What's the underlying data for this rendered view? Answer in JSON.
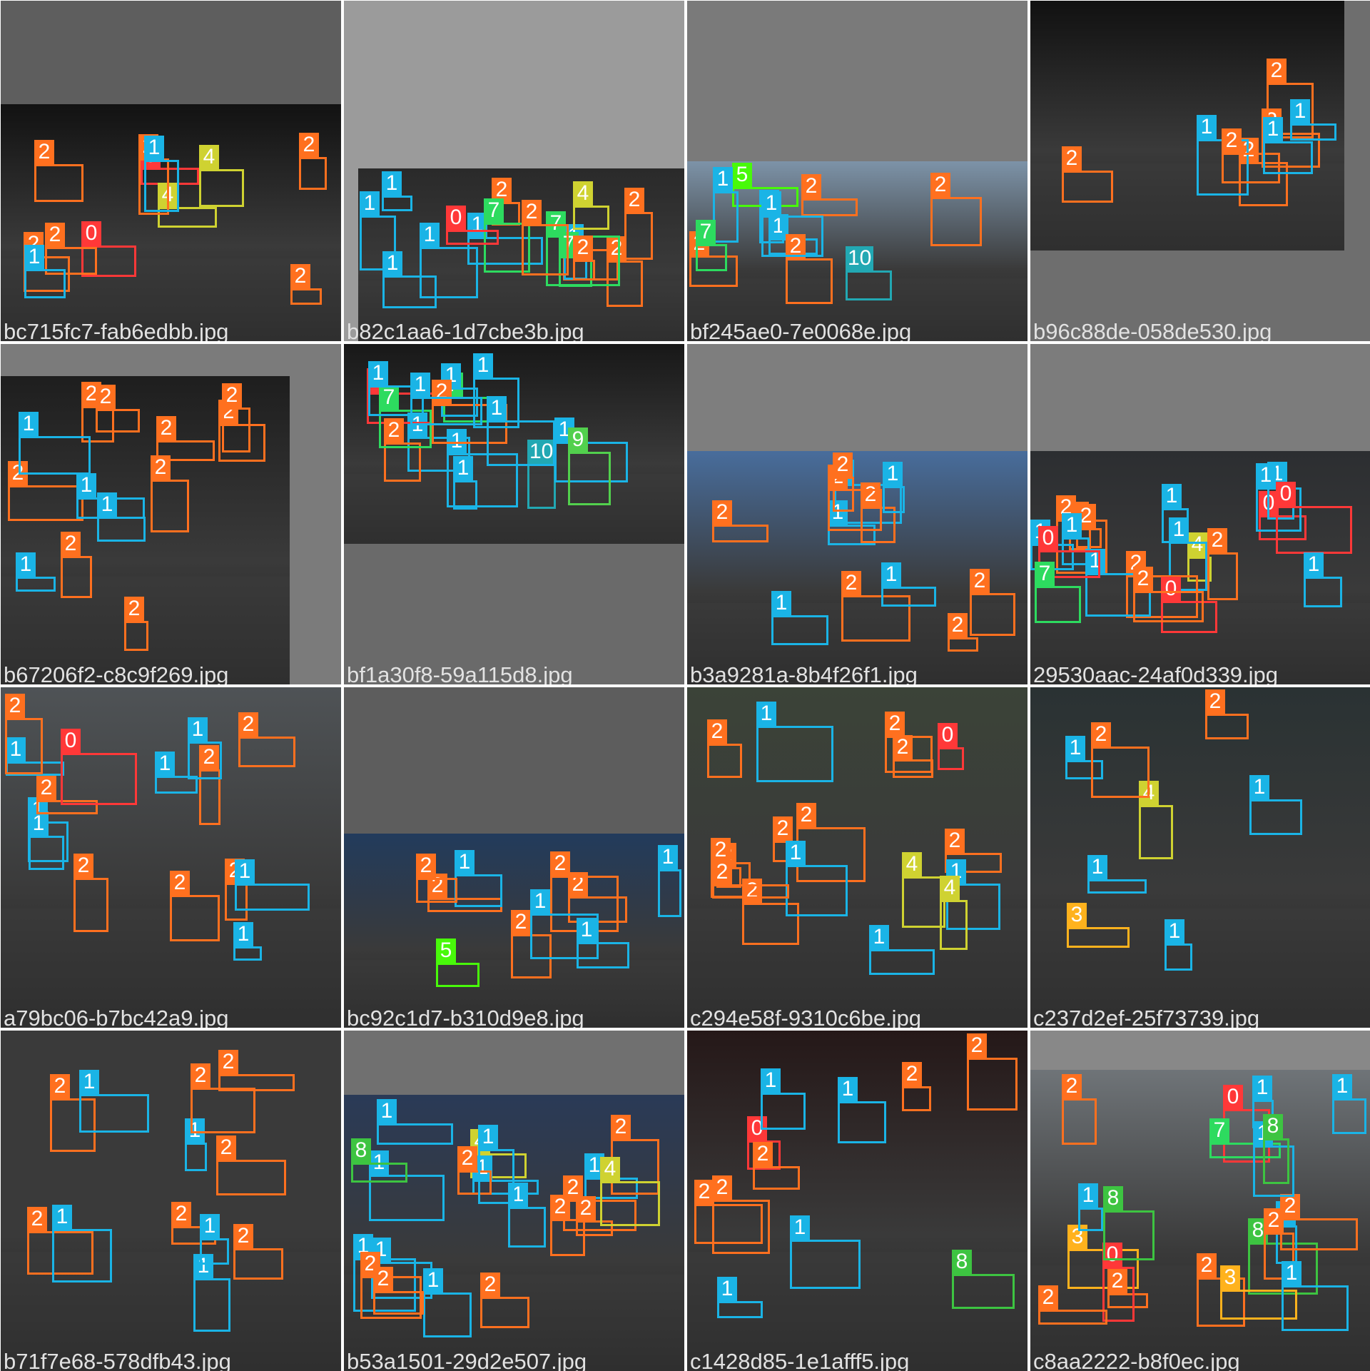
{
  "class_colors": {
    "0": "#ff3838",
    "1": "#1ab4e6",
    "2": "#ff701f",
    "3": "#ffb21d",
    "4": "#cfd231",
    "5": "#48f90a",
    "7": "#2ddb5f",
    "8": "#3dc441",
    "9": "#52d04d",
    "10": "#22a8b3"
  },
  "tiles": [
    {
      "filename": "bc715fc7-fab6edbb.jpg",
      "bg": "#5e5e5e",
      "photo_bg": "#121212",
      "detections": [
        "2",
        "2",
        "0",
        "0",
        "4",
        "2",
        "2",
        "4",
        "2",
        "2",
        "1",
        "1"
      ]
    },
    {
      "filename": "b82c1aa6-1d7cbe3b.jpg",
      "bg": "#9b9b9b",
      "photo_bg": "#2a2a2a",
      "detections": [
        "2",
        "2",
        "1",
        "1",
        "7",
        "4",
        "2",
        "7",
        "0",
        "7",
        "1",
        "1",
        "2",
        "2",
        "2",
        "1",
        "1"
      ]
    },
    {
      "filename": "bf245ae0-7e0068e.jpg",
      "bg": "#7a7a7a",
      "photo_bg": "#7d93a8",
      "detections": [
        "2",
        "1",
        "1",
        "5",
        "2",
        "2",
        "2",
        "1",
        "1",
        "7",
        "10"
      ]
    },
    {
      "filename": "b96c88de-058de530.jpg",
      "bg": "#6e6e6e",
      "photo_bg": "#111111",
      "detections": [
        "2",
        "2",
        "2",
        "2",
        "1",
        "1",
        "2",
        "1"
      ]
    },
    {
      "filename": "b67206f2-c8c9f269.jpg",
      "bg": "#7b7b7b",
      "photo_bg": "#1e1e1e",
      "detections": [
        "2",
        "2",
        "2",
        "2",
        "2",
        "2",
        "1",
        "1",
        "1",
        "1",
        "2",
        "2",
        "2"
      ]
    },
    {
      "filename": "bf1a30f8-59a115d8.jpg",
      "bg": "#6a6a6a",
      "photo_bg": "#181818",
      "detections": [
        "7",
        "1",
        "1",
        "0",
        "10",
        "1",
        "1",
        "2",
        "2",
        "7",
        "1",
        "1",
        "9",
        "1",
        "1",
        "1"
      ]
    },
    {
      "filename": "b3a9281a-8b4f26f1.jpg",
      "bg": "#7e7e7e",
      "photo_bg": "#486d9c",
      "detections": [
        "1",
        "1",
        "2",
        "2",
        "2",
        "2",
        "2",
        "2",
        "2",
        "1",
        "1",
        "1"
      ]
    },
    {
      "filename": "29530aac-24af0d339.jpg",
      "bg": "#7c7c7c",
      "photo_bg": "#2c2e31",
      "detections": [
        "2",
        "4",
        "2",
        "2",
        "1",
        "1",
        "2",
        "0",
        "0",
        "1",
        "1",
        "1",
        "1",
        "0",
        "7",
        "1",
        "0",
        "1",
        "2",
        "2"
      ]
    },
    {
      "filename": "a79bc06-b7bc42a9.jpg",
      "bg": "#6f6f6f",
      "photo_bg": "#4f5356",
      "detections": [
        "1",
        "1",
        "2",
        "2",
        "2",
        "1",
        "1",
        "2",
        "1",
        "1",
        "2",
        "1",
        "2",
        "2",
        "0"
      ]
    },
    {
      "filename": "bc92c1d7-b310d9e8.jpg",
      "bg": "#5d5d5d",
      "photo_bg": "#223b5c",
      "detections": [
        "2",
        "5",
        "2",
        "2",
        "2",
        "1",
        "1",
        "1",
        "1",
        "2"
      ]
    },
    {
      "filename": "c294e58f-9310c6be.jpg",
      "bg": "#777777",
      "photo_bg": "#3b4338",
      "detections": [
        "2",
        "2",
        "2",
        "2",
        "2",
        "2",
        "2",
        "2",
        "1",
        "1",
        "4",
        "2",
        "1",
        "1",
        "0",
        "4",
        "2"
      ]
    },
    {
      "filename": "c237d2ef-25f73739.jpg",
      "bg": "#6c6c6c",
      "photo_bg": "#2a3233",
      "detections": [
        "3",
        "1",
        "1",
        "1",
        "1",
        "2",
        "4",
        "2"
      ]
    },
    {
      "filename": "b71f7e68-578dfb43.jpg",
      "bg": "#777777",
      "photo_bg": "#3a3a3a",
      "detections": [
        "2",
        "2",
        "2",
        "2",
        "2",
        "1",
        "1",
        "1",
        "1",
        "1",
        "2",
        "2"
      ]
    },
    {
      "filename": "b53a1501-29d2e507.jpg",
      "bg": "#707070",
      "photo_bg": "#2a3a57",
      "detections": [
        "1",
        "1",
        "2",
        "4",
        "2",
        "1",
        "1",
        "1",
        "1",
        "1",
        "2",
        "2",
        "2",
        "8",
        "1",
        "1",
        "2",
        "2",
        "4",
        "2"
      ]
    },
    {
      "filename": "c1428d85-1e1afff5.jpg",
      "bg": "#7a7a7a",
      "photo_bg": "#251818",
      "detections": [
        "0",
        "2",
        "1",
        "1",
        "2",
        "2",
        "2",
        "8",
        "1",
        "1",
        "2"
      ]
    },
    {
      "filename": "c8aa2222-b8f0ec.jpg",
      "bg": "#888888",
      "photo_bg": "#6f7478",
      "detections": [
        "3",
        "2",
        "2",
        "8",
        "1",
        "0",
        "1",
        "0",
        "1",
        "1",
        "7",
        "3",
        "8",
        "2",
        "2",
        "2",
        "2",
        "1",
        "1",
        "8"
      ]
    }
  ]
}
